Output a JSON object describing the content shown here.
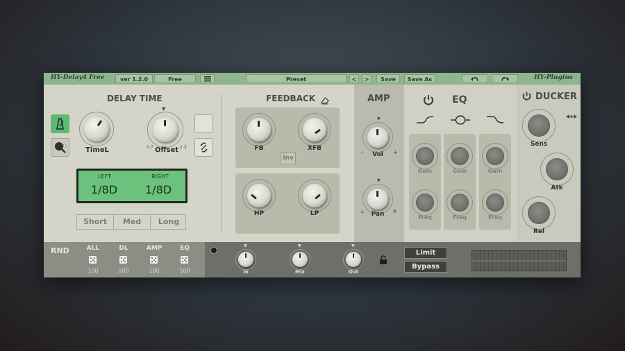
{
  "topbar": {
    "plugin_name": "HY-Delay4 Free",
    "version": "ver 1.2.0",
    "edition": "Free",
    "preset_label": "Preset",
    "prev_preset": "<",
    "next_preset": ">",
    "save": "Save",
    "save_as": "Save As",
    "brand": "HY-Plugins"
  },
  "delay": {
    "title": "DELAY TIME",
    "knob1_label": "TimeL",
    "knob2_label": "Offset",
    "offset_min": "0.7",
    "offset_max": "1.3",
    "display_left_label": "LEFT",
    "display_right_label": "RIGHT",
    "display_left_value": "1/8D",
    "display_right_value": "1/8D",
    "mode_buttons": [
      "Short",
      "Med",
      "Long"
    ]
  },
  "feedback": {
    "title": "FEEDBACK",
    "fb": "FB",
    "xfb": "XFB",
    "inv": "Inv",
    "hp": "HP",
    "lp": "LP"
  },
  "amp": {
    "title": "AMP",
    "vol": "Vol",
    "pan": "Pan",
    "pan_l": "L",
    "pan_r": "R"
  },
  "eq": {
    "title": "EQ",
    "gain": "Gain",
    "freq": "Freq"
  },
  "ducker": {
    "title": "DUCKER",
    "sens": "Sens",
    "atk": "Atk",
    "rel": "Rel"
  },
  "bottom": {
    "rnd": "RND",
    "rnd_items": [
      {
        "label": "ALL",
        "value": "100"
      },
      {
        "label": "DL",
        "value": "100"
      },
      {
        "label": "AMP",
        "value": "100"
      },
      {
        "label": "EQ",
        "value": "100"
      }
    ],
    "in": "In",
    "mix": "Mix",
    "out": "Out",
    "limit": "Limit",
    "bypass": "Bypass"
  },
  "colors": {
    "accent_green": "#5fb873",
    "panel": "#d4d5c8",
    "topbar": "#8fb58e"
  }
}
